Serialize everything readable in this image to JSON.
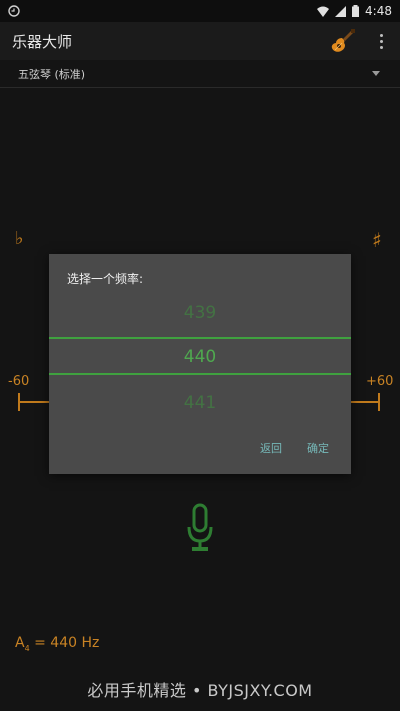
{
  "status_bar": {
    "time": "4:48"
  },
  "app_bar": {
    "title": "乐器大师"
  },
  "instrument_selector": {
    "selected": "五弦琴 (标准)"
  },
  "meter": {
    "flat_symbol": "♭",
    "sharp_symbol": "♯",
    "min_label": "-60",
    "max_label": "+60"
  },
  "reference": {
    "note": "A",
    "octave": "4",
    "value": " = 440 Hz"
  },
  "watermark": "必用手机精选 • BYJSJXY.COM",
  "dialog": {
    "title": "选择一个频率:",
    "prev_value": "439",
    "current_value": "440",
    "next_value": "441",
    "cancel_label": "返回",
    "ok_label": "确定"
  },
  "colors": {
    "accent_orange": "#c07a1c",
    "picker_green": "#4fa84f",
    "button_teal": "#76b8b8"
  }
}
